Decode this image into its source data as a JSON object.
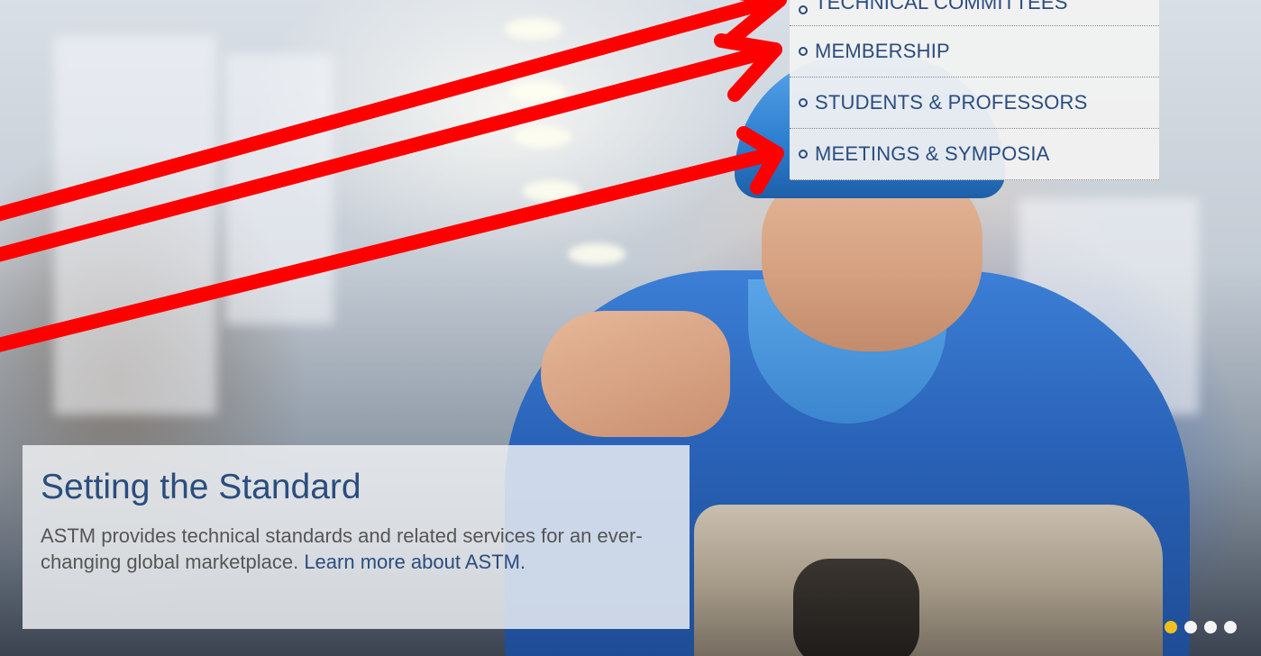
{
  "menu": {
    "items": [
      {
        "label": "TECHNICAL COMMITTEES"
      },
      {
        "label": "MEMBERSHIP"
      },
      {
        "label": "STUDENTS & PROFESSORS"
      },
      {
        "label": "MEETINGS & SYMPOSIA"
      }
    ]
  },
  "hero": {
    "title": "Setting the Standard",
    "text_start": "ASTM provides technical standards and related services for an ever-changing global marketplace.",
    "link_text": "Learn more about ASTM."
  },
  "slider": {
    "total_dots": 4,
    "active_index": 0
  },
  "colors": {
    "menu_text": "#2a4d7e",
    "annotation_arrow": "#ff0000",
    "active_dot": "#f0c020"
  }
}
